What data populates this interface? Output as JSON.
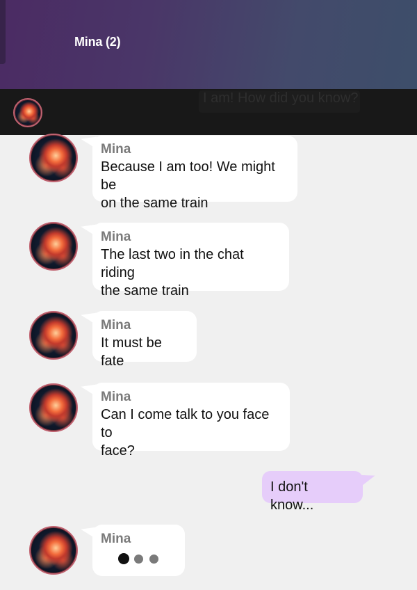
{
  "header": {
    "title": "Mina (2)"
  },
  "faded_message": "I am! How did you know?",
  "messages": [
    {
      "sender": "Mina",
      "text_lines": [
        "Because I am too! We might be",
        "on the same train"
      ]
    },
    {
      "sender": "Mina",
      "text_lines": [
        "The last two in the chat riding",
        "the same train"
      ]
    },
    {
      "sender": "Mina",
      "text_lines": [
        "It must be fate"
      ]
    },
    {
      "sender": "Mina",
      "text_lines": [
        "Can I come talk to you face to",
        "face?"
      ]
    }
  ],
  "my_reply": {
    "text": "I don't know..."
  },
  "typing": {
    "sender": "Mina"
  },
  "colors": {
    "incoming_bubble": "#ffffff",
    "outgoing_bubble": "#e6cdfa",
    "sender_name": "#7a7a7a",
    "avatar_ring": "#c06270",
    "background": "#f0f0f0"
  }
}
